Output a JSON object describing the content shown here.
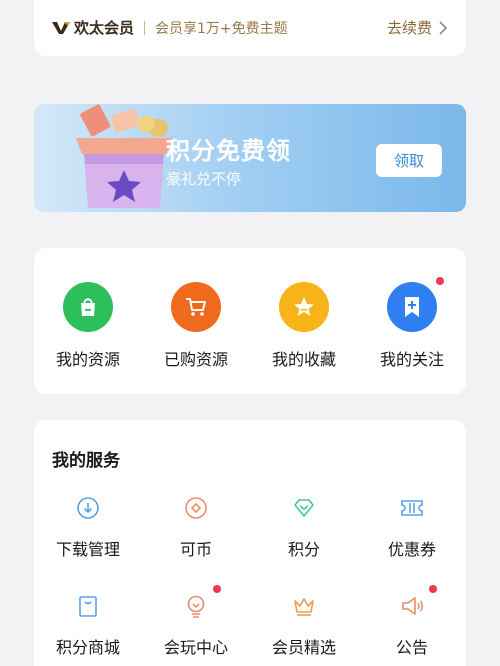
{
  "vip": {
    "name": "欢太会员",
    "desc": "会员享1万+免费主题",
    "renew": "去续费"
  },
  "banner": {
    "title": "积分免费领",
    "subtitle": "豪礼兑不停",
    "button": "领取"
  },
  "quick_actions": [
    {
      "label": "我的资源",
      "icon": "shopping-bag-icon",
      "color": "#2fbf5a"
    },
    {
      "label": "已购资源",
      "icon": "cart-icon",
      "color": "#f06a1e"
    },
    {
      "label": "我的收藏",
      "icon": "star-icon",
      "color": "#f7b318"
    },
    {
      "label": "我的关注",
      "icon": "bookmark-plus-icon",
      "color": "#2f7ff0"
    }
  ],
  "services": {
    "title": "我的服务",
    "items": [
      {
        "label": "下载管理",
        "icon": "download-icon",
        "color": "#5aa0ea"
      },
      {
        "label": "可币",
        "icon": "coin-icon",
        "color": "#ee8a6c"
      },
      {
        "label": "积分",
        "icon": "diamond-icon",
        "color": "#48c4a6"
      },
      {
        "label": "优惠券",
        "icon": "ticket-icon",
        "color": "#5aa0ea"
      },
      {
        "label": "积分商城",
        "icon": "store-bag-icon",
        "color": "#5aa0ea"
      },
      {
        "label": "会玩中心",
        "icon": "lightbulb-icon",
        "color": "#ee8a6c"
      },
      {
        "label": "会员精选",
        "icon": "crown-icon",
        "color": "#ee9a4c"
      },
      {
        "label": "公告",
        "icon": "megaphone-icon",
        "color": "#ee8a6c"
      }
    ]
  },
  "colors": {
    "background": "#f2f2f4",
    "badge": "#e9394a",
    "vip_gold": "#9a7a4c"
  }
}
